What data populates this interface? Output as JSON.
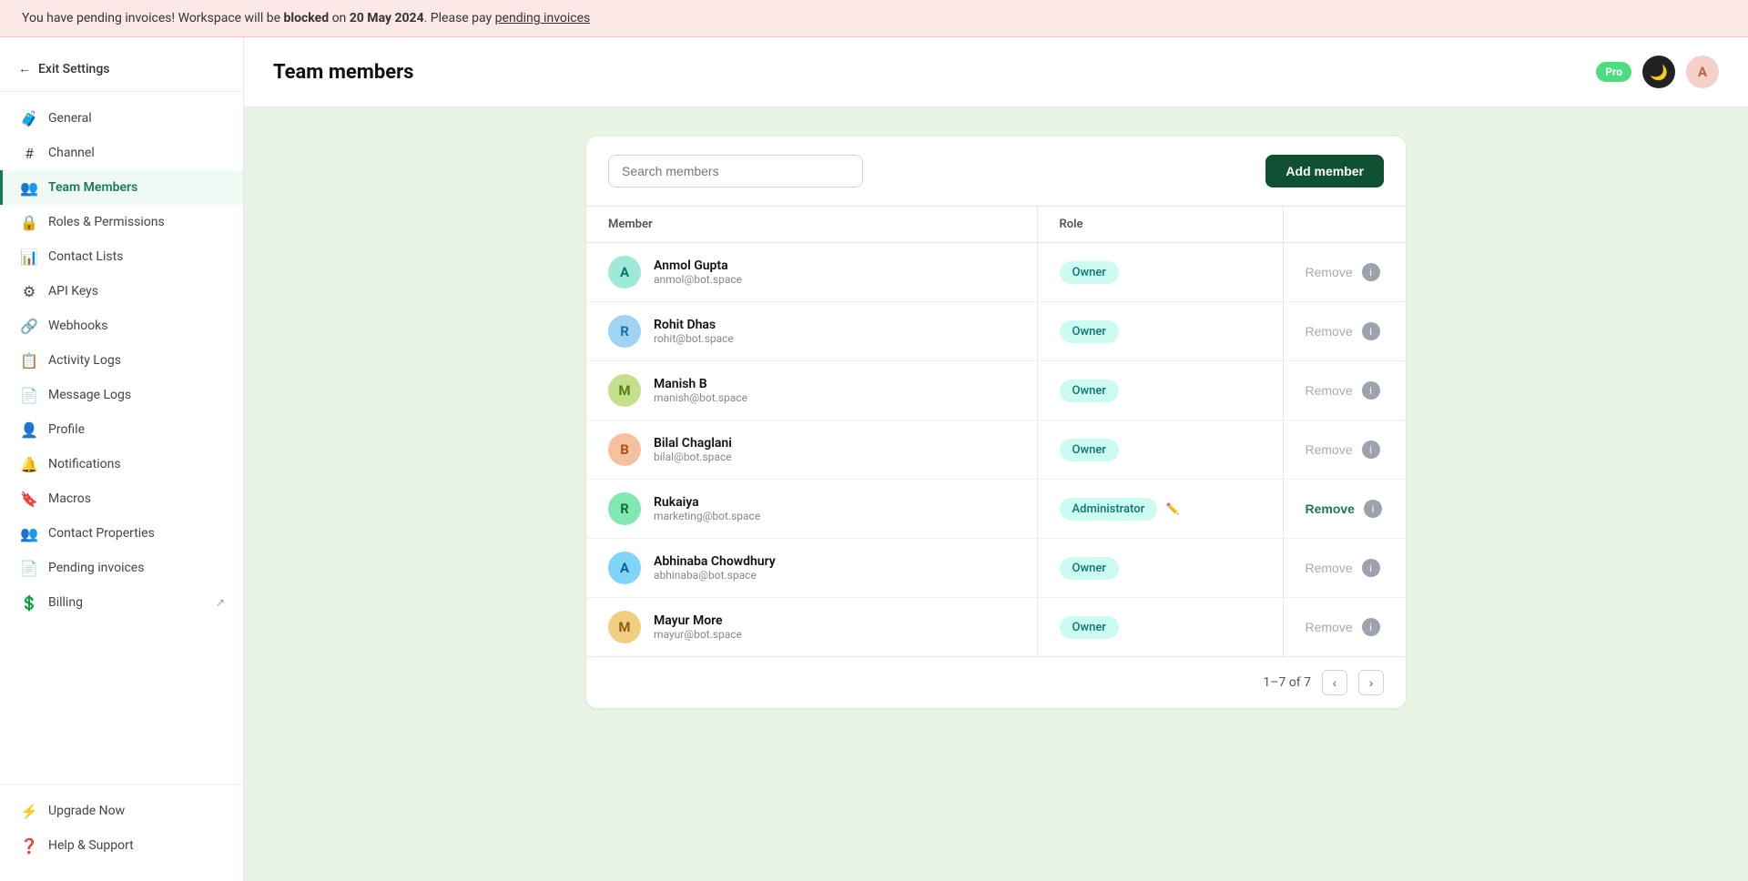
{
  "banner": {
    "text_prefix": "You have pending invoices! Workspace will be ",
    "bold1": "blocked",
    "text_mid": " on ",
    "bold2": "20 May 2024",
    "text_suffix": ". Please pay ",
    "link_text": "pending invoices"
  },
  "sidebar": {
    "exit_label": "Exit Settings",
    "nav_items": [
      {
        "id": "general",
        "label": "General",
        "icon": "🧳",
        "active": false
      },
      {
        "id": "channel",
        "label": "Channel",
        "icon": "#",
        "active": false
      },
      {
        "id": "team-members",
        "label": "Team Members",
        "icon": "👥",
        "active": true
      },
      {
        "id": "roles-permissions",
        "label": "Roles & Permissions",
        "icon": "🔒",
        "active": false
      },
      {
        "id": "contact-lists",
        "label": "Contact Lists",
        "icon": "📊",
        "active": false
      },
      {
        "id": "api-keys",
        "label": "API Keys",
        "icon": "⚙",
        "active": false
      },
      {
        "id": "webhooks",
        "label": "Webhooks",
        "icon": "🔗",
        "active": false
      },
      {
        "id": "activity-logs",
        "label": "Activity Logs",
        "icon": "📋",
        "active": false
      },
      {
        "id": "message-logs",
        "label": "Message Logs",
        "icon": "📄",
        "active": false
      },
      {
        "id": "profile",
        "label": "Profile",
        "icon": "👤",
        "active": false
      },
      {
        "id": "notifications",
        "label": "Notifications",
        "icon": "🔔",
        "active": false
      },
      {
        "id": "macros",
        "label": "Macros",
        "icon": "🔖",
        "active": false
      },
      {
        "id": "contact-properties",
        "label": "Contact Properties",
        "icon": "👥",
        "active": false
      },
      {
        "id": "pending-invoices",
        "label": "Pending invoices",
        "icon": "📄",
        "active": false
      },
      {
        "id": "billing",
        "label": "Billing",
        "icon": "💲",
        "active": false,
        "external": true
      }
    ],
    "bottom_items": [
      {
        "id": "upgrade-now",
        "label": "Upgrade Now",
        "icon": "⚡"
      },
      {
        "id": "help-support",
        "label": "Help & Support",
        "icon": "❓"
      }
    ]
  },
  "header": {
    "title": "Team members",
    "pro_badge": "Pro",
    "user_initial": "A"
  },
  "toolbar": {
    "search_placeholder": "Search members",
    "add_button_label": "Add member"
  },
  "table": {
    "col_member": "Member",
    "col_role": "Role",
    "members": [
      {
        "initial": "A",
        "name": "Anmol Gupta",
        "email": "anmol@bot.space",
        "role": "Owner",
        "role_type": "owner",
        "can_remove": false,
        "avatar_bg": "#a0e8d8",
        "avatar_color": "#0f766e"
      },
      {
        "initial": "R",
        "name": "Rohit Dhas",
        "email": "rohit@bot.space",
        "role": "Owner",
        "role_type": "owner",
        "can_remove": false,
        "avatar_bg": "#a0d4f5",
        "avatar_color": "#1e6fa8"
      },
      {
        "initial": "M",
        "name": "Manish B",
        "email": "manish@bot.space",
        "role": "Owner",
        "role_type": "owner",
        "can_remove": false,
        "avatar_bg": "#c5e08a",
        "avatar_color": "#5a7a1a"
      },
      {
        "initial": "B",
        "name": "Bilal Chaglani",
        "email": "bilal@bot.space",
        "role": "Owner",
        "role_type": "owner",
        "can_remove": false,
        "avatar_bg": "#f5c0a0",
        "avatar_color": "#b05020"
      },
      {
        "initial": "R",
        "name": "Rukaiya",
        "email": "marketing@bot.space",
        "role": "Administrator",
        "role_type": "admin",
        "can_remove": true,
        "avatar_bg": "#80e8b0",
        "avatar_color": "#0f7040"
      },
      {
        "initial": "A",
        "name": "Abhinaba Chowdhury",
        "email": "abhinaba@bot.space",
        "role": "Owner",
        "role_type": "owner",
        "can_remove": false,
        "avatar_bg": "#80d4f5",
        "avatar_color": "#1060a0"
      },
      {
        "initial": "M",
        "name": "Mayur More",
        "email": "mayur@bot.space",
        "role": "Owner",
        "role_type": "owner",
        "can_remove": false,
        "avatar_bg": "#f0d080",
        "avatar_color": "#8a6010"
      }
    ]
  },
  "pagination": {
    "label": "1–7 of 7"
  }
}
